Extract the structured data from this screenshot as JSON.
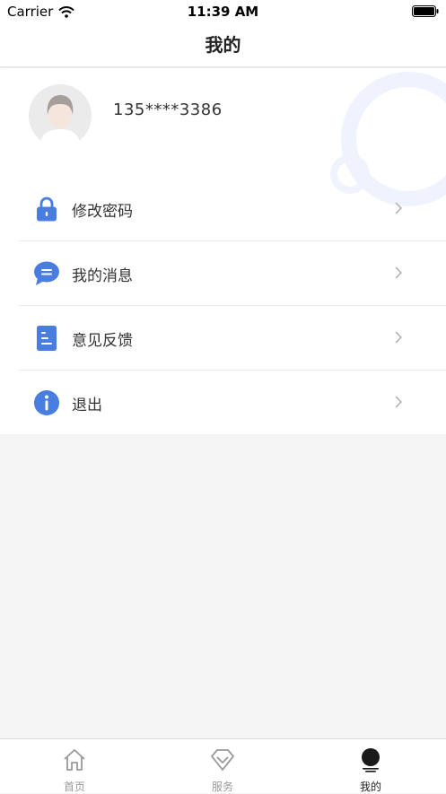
{
  "status_bar": {
    "carrier": "Carrier",
    "time": "11:39 AM"
  },
  "nav": {
    "title": "我的"
  },
  "profile": {
    "phone": "135****3386"
  },
  "menu": [
    {
      "label": "修改密码",
      "icon": "lock-icon"
    },
    {
      "label": "我的消息",
      "icon": "chat-bubble-icon"
    },
    {
      "label": "意见反馈",
      "icon": "document-icon"
    },
    {
      "label": "退出",
      "icon": "info-icon"
    }
  ],
  "tabs": [
    {
      "label": "首页",
      "icon": "home-icon",
      "active": false
    },
    {
      "label": "服务",
      "icon": "diamond-icon",
      "active": false
    },
    {
      "label": "我的",
      "icon": "profile-icon",
      "active": true
    }
  ],
  "colors": {
    "accent": "#4a7de0",
    "deco": "#eef3fd",
    "background": "#f5f5f5"
  }
}
